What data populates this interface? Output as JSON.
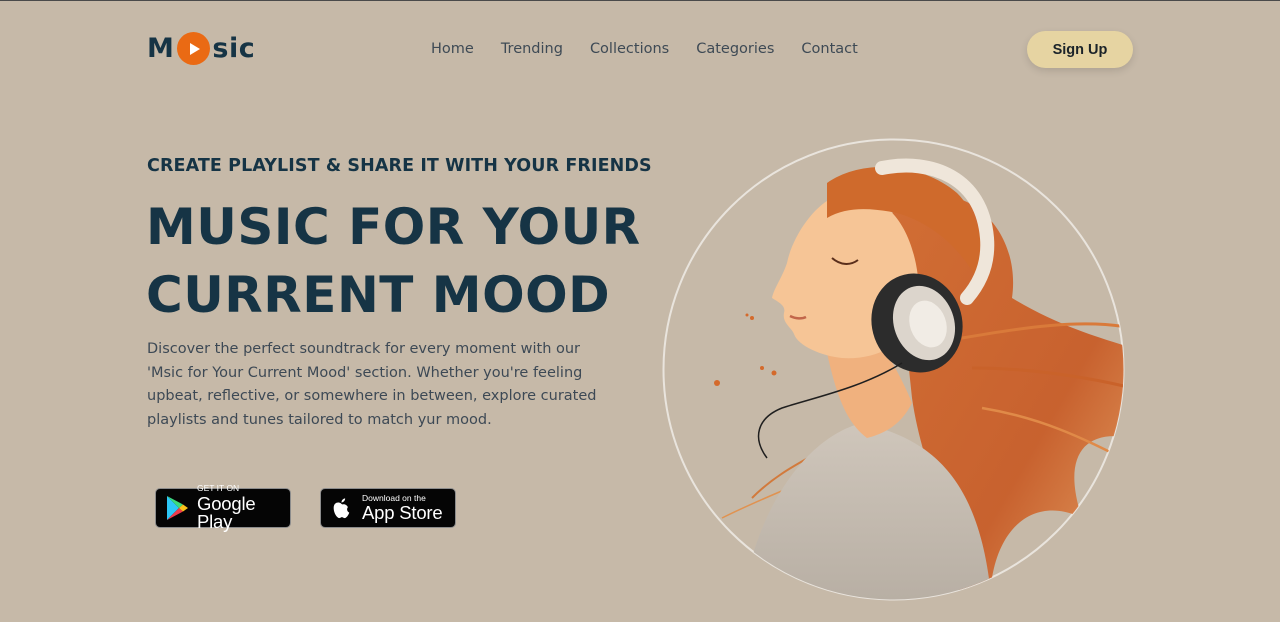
{
  "header": {
    "logo_prefix": "M",
    "logo_suffix": "sic",
    "nav": [
      "Home",
      "Trending",
      "Collections",
      "Categories",
      "Contact"
    ],
    "signup_label": "Sign Up"
  },
  "hero": {
    "eyebrow": "CREATE PLAYLIST & SHARE IT WITH YOUR FRIENDS",
    "headline_line1": "MUSIC FOR YOUR",
    "headline_line2": "CURRENT MOOD",
    "description": "Discover the perfect soundtrack for every moment with our 'Msic for Your Current Mood' section. Whether you're feeling upbeat, reflective, or somewhere in between, explore curated playlists and tunes tailored to match yur mood."
  },
  "badges": {
    "google_small": "GET IT ON",
    "google_big": "Google Play",
    "apple_small": "Download on the",
    "apple_big": "App Store"
  },
  "colors": {
    "background": "#c6b9a8",
    "text_dark": "#163445",
    "accent_orange": "#ea6a14",
    "button_bg": "#e6d4a2"
  }
}
